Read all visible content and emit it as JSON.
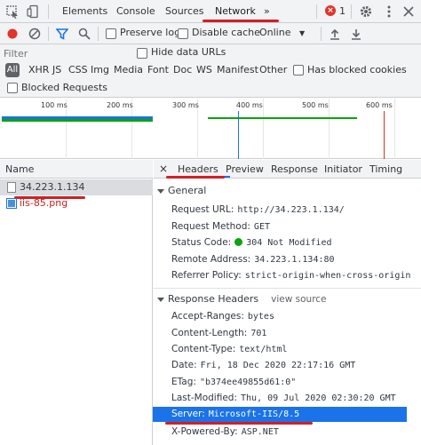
{
  "tabs": [
    "Elements",
    "Console",
    "Sources",
    "Network",
    "»"
  ],
  "error_count": "1",
  "network_toolbar": {
    "preserve_log": "Preserve log",
    "disable_cache": "Disable cache",
    "throttle": "Online"
  },
  "filter": {
    "placeholder": "Filter",
    "hide_data_urls": "Hide data URLs"
  },
  "types": [
    "All",
    "XHR",
    "JS",
    "CSS",
    "Img",
    "Media",
    "Font",
    "Doc",
    "WS",
    "Manifest",
    "Other"
  ],
  "has_blocked_cookies": "Has blocked cookies",
  "blocked_requests": "Blocked Requests",
  "timeline_ticks": [
    "100 ms",
    "200 ms",
    "300 ms",
    "400 ms",
    "500 ms",
    "600 ms"
  ],
  "name_column": {
    "header": "Name",
    "requests": [
      "34.223.1.134",
      "iis-85.png"
    ]
  },
  "detail_tabs": [
    "×",
    "Headers",
    "Preview",
    "Response",
    "Initiator",
    "Timing"
  ],
  "general": {
    "title": "General",
    "rows": [
      {
        "k": "Request URL:",
        "v": "http://34.223.1.134/"
      },
      {
        "k": "Request Method:",
        "v": "GET"
      },
      {
        "k": "Status Code:",
        "v": "304 Not Modified"
      },
      {
        "k": "Remote Address:",
        "v": "34.223.1.134:80"
      },
      {
        "k": "Referrer Policy:",
        "v": "strict-origin-when-cross-origin"
      }
    ]
  },
  "response_headers": {
    "title": "Response Headers",
    "view_source": "view source",
    "rows": [
      {
        "k": "Accept-Ranges:",
        "v": "bytes"
      },
      {
        "k": "Content-Length:",
        "v": "701"
      },
      {
        "k": "Content-Type:",
        "v": "text/html"
      },
      {
        "k": "Date:",
        "v": "Fri, 18 Dec 2020 22:17:16 GMT"
      },
      {
        "k": "ETag:",
        "v": "\"b374ee49855d61:0\""
      },
      {
        "k": "Last-Modified:",
        "v": "Thu, 09 Jul 2020 02:30:20 GMT"
      },
      {
        "k": "Server:",
        "v": "Microsoft-IIS/8.5"
      },
      {
        "k": "X-Powered-By:",
        "v": "ASP.NET"
      }
    ]
  },
  "colors": {
    "accent": "#1a73e8",
    "annotation_red": "#d41e24",
    "status_green": "#0ca40c",
    "error_red": "#e0352b"
  }
}
